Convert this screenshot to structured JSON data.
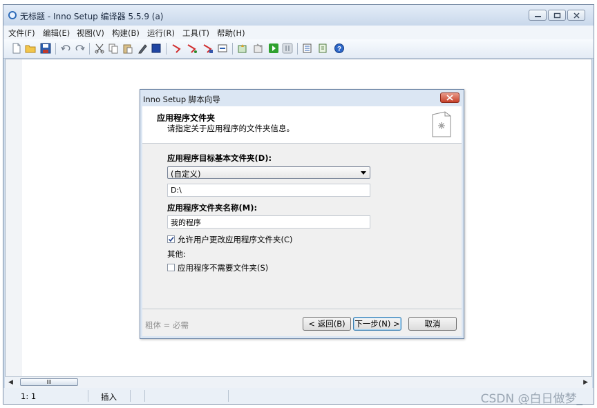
{
  "window": {
    "title": "无标题 - Inno Setup 编译器 5.5.9 (a)"
  },
  "menu": [
    "文件(F)",
    "编辑(E)",
    "视图(V)",
    "构建(B)",
    "运行(R)",
    "工具(T)",
    "帮助(H)"
  ],
  "toolbar": {
    "buttons": [
      "new-file-icon",
      "open-folder-icon",
      "save-icon",
      "undo-icon",
      "redo-icon",
      "cut-icon",
      "copy-icon",
      "paste-icon",
      "pencil-icon",
      "select-all-icon",
      "compile-icon",
      "compile-all-icon",
      "stop-compile-icon",
      "output-icon",
      "wizard-icon",
      "setup-icon",
      "run-icon",
      "pause-icon",
      "target-icon",
      "script-icon",
      "help-icon"
    ]
  },
  "status": {
    "position": "1:  1",
    "mode": "插入",
    "watermark": "CSDN @白日做梦_"
  },
  "scrollbar": {
    "grip": "III"
  },
  "dialog": {
    "title": "Inno Setup 脚本向导",
    "header_title": "应用程序文件夹",
    "header_subtitle": "请指定关于应用程序的文件夹信息。",
    "base_folder_label": "应用程序目标基本文件夹(D):",
    "base_folder_value": "(自定义)",
    "custom_path_value": "D:\\",
    "folder_name_label": "应用程序文件夹名称(M):",
    "folder_name_value": "我的程序",
    "allow_change_label": "允许用户更改应用程序文件夹(C)",
    "allow_change_checked": true,
    "other_label": "其他:",
    "no_folder_label": "应用程序不需要文件夹(S)",
    "no_folder_checked": false,
    "required_hint": "粗体 = 必需",
    "back_button": "< 返回(B)",
    "next_button": "下一步(N) >",
    "cancel_button": "取消"
  }
}
